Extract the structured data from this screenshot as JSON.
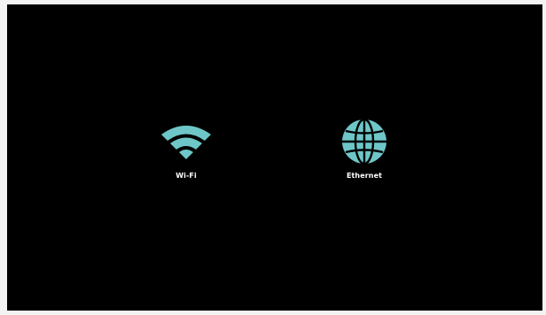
{
  "colors": {
    "background": "#000000",
    "icon": "#6ec6c8",
    "label": "#ffffff"
  },
  "options": [
    {
      "label": "Wi-Fi",
      "icon": "wifi-icon"
    },
    {
      "label": "Ethernet",
      "icon": "globe-icon"
    }
  ]
}
